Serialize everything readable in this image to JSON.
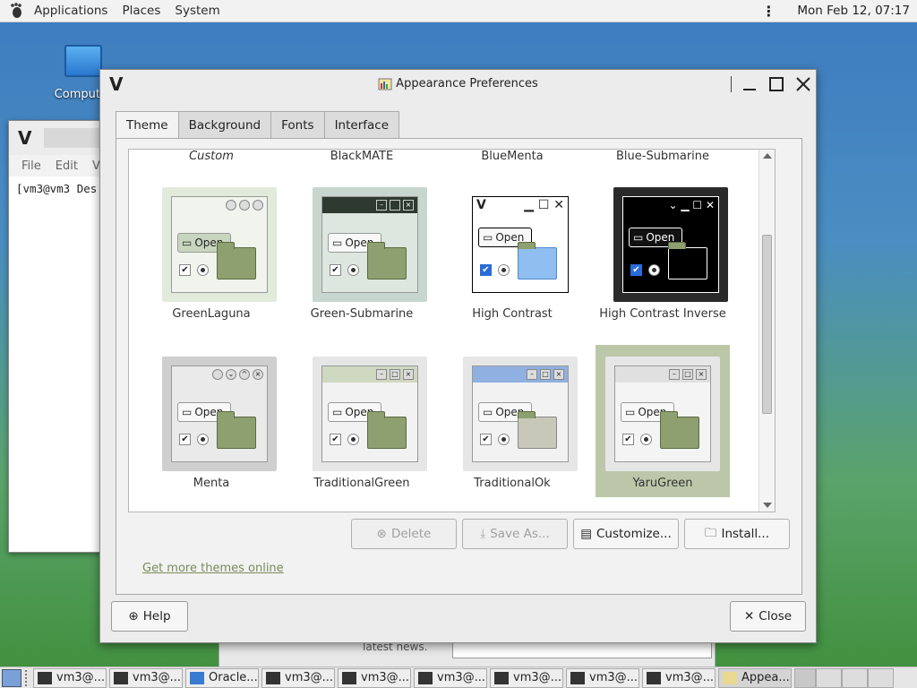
{
  "topbar": {
    "menus": [
      "Applications",
      "Places",
      "System"
    ],
    "clock": "Mon Feb 12, 07:17"
  },
  "desktop": {
    "computer_label": "Computer"
  },
  "terminal": {
    "title_glyph": "V",
    "menus": [
      "File",
      "Edit",
      "V"
    ],
    "prompt": "[vm3@vm3 Des"
  },
  "background_window": {
    "text": "latest news."
  },
  "dialog": {
    "title": "Appearance Preferences",
    "wm_glyph": "V",
    "tabs": [
      "Theme",
      "Background",
      "Fonts",
      "Interface"
    ],
    "active_tab": "Theme",
    "top_row_labels": [
      "Custom",
      "BlackMATE",
      "BlueMenta",
      "Blue-Submarine"
    ],
    "themes": [
      {
        "name": "GreenLaguna"
      },
      {
        "name": "Green-Submarine"
      },
      {
        "name": "High Contrast"
      },
      {
        "name": "High Contrast Inverse"
      },
      {
        "name": "Menta"
      },
      {
        "name": "TraditionalGreen"
      },
      {
        "name": "TraditionalOk"
      },
      {
        "name": "YaruGreen",
        "selected": true
      }
    ],
    "open_label": "Open",
    "buttons": {
      "delete": "Delete",
      "save_as": "Save As...",
      "customize": "Customize...",
      "install": "Install..."
    },
    "link": "Get more themes online",
    "help": "Help",
    "close": "Close"
  },
  "taskbar": {
    "items": [
      "vm3@...",
      "vm3@...",
      "Oracle...",
      "vm3@...",
      "vm3@...",
      "vm3@...",
      "vm3@...",
      "vm3@...",
      "vm3@...",
      "Appea..."
    ]
  }
}
